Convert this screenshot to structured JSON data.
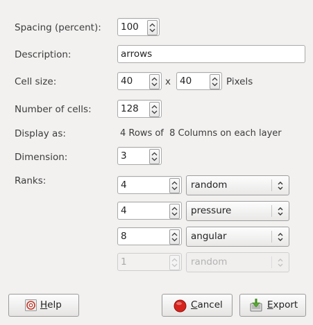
{
  "form": {
    "spacing": {
      "label": "Spacing (percent):",
      "value": "100"
    },
    "description": {
      "label": "Description:",
      "value": "arrows"
    },
    "cell_size": {
      "label": "Cell size:",
      "width": "40",
      "times": "x",
      "height": "40",
      "unit": "Pixels"
    },
    "num_cells": {
      "label": "Number of cells:",
      "value": "128"
    },
    "display_as": {
      "label": "Display as:",
      "value": "4 Rows of  8 Columns on each layer"
    },
    "dimension": {
      "label": "Dimension:",
      "value": "3"
    },
    "ranks": {
      "label": "Ranks:",
      "rows": [
        {
          "value": "4",
          "mode": "random",
          "enabled": true
        },
        {
          "value": "4",
          "mode": "pressure",
          "enabled": true
        },
        {
          "value": "8",
          "mode": "angular",
          "enabled": true
        },
        {
          "value": "1",
          "mode": "random",
          "enabled": false
        }
      ]
    }
  },
  "buttons": {
    "help": {
      "mnemonic": "H",
      "rest": "elp"
    },
    "cancel": {
      "mnemonic": "C",
      "rest": "ancel"
    },
    "export": {
      "mnemonic": "E",
      "rest": "xport"
    }
  },
  "icons": {
    "help": "help-icon",
    "cancel": "cancel-icon",
    "export": "export-icon",
    "spin": "spin-arrows-icon",
    "combo": "combo-arrows-icon"
  },
  "colors": {
    "window_bg": "#f2f1f0",
    "cancel_red": "#d6231c",
    "export_green": "#5aa832",
    "help_red": "#c0392b"
  }
}
